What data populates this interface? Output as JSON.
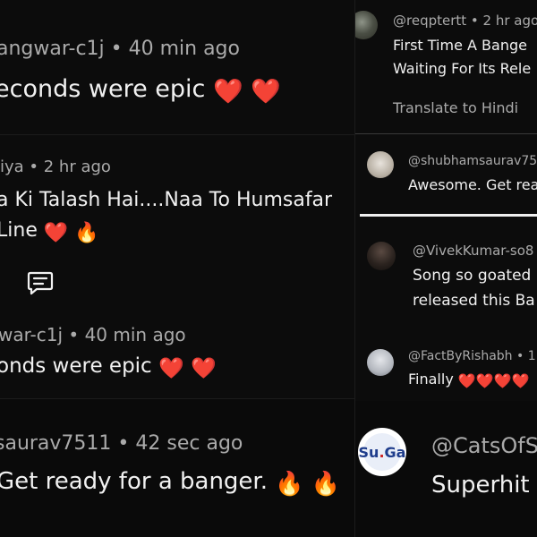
{
  "left_panels": [
    {
      "meta": "angwar-c1j • 40 min ago",
      "lines": [
        {
          "text": "econds were epic",
          "emoji": [
            "❤️",
            "❤️"
          ]
        }
      ]
    },
    {
      "meta": "iya • 2 hr ago",
      "lines": [
        {
          "text": "a Ki Talash Hai....Naa To Humsafar",
          "emoji": []
        },
        {
          "text": "Line",
          "emoji": [
            "❤️",
            "🔥"
          ]
        }
      ]
    },
    {
      "meta": "war-c1j • 40 min ago",
      "lines": [
        {
          "text": "onds were epic",
          "emoji": [
            "❤️",
            "❤️"
          ]
        }
      ]
    },
    {
      "meta": "saurav7511 • 42 sec ago",
      "lines": [
        {
          "text": "Get ready for a banger.",
          "emoji": [
            "🔥",
            "🔥"
          ]
        }
      ]
    }
  ],
  "right_comments": [
    {
      "handle": "@reqptertt • 2 hr ago",
      "lines": [
        "First Time A Bange",
        "Waiting For Its Rele"
      ],
      "translate": "Translate to Hindi"
    },
    {
      "handle": "@shubhamsaurav75",
      "lines": [
        "Awesome. Get rea"
      ]
    },
    {
      "handle": "@VivekKumar-so8",
      "lines": [
        "Song so goated",
        "released this Ba"
      ]
    },
    {
      "handle": "@FactByRishabh • 1",
      "lines": [
        "Finally"
      ],
      "emoji": [
        "❤️",
        "❤️",
        "❤️",
        "❤️"
      ]
    },
    {
      "handle": "@CatsOfS",
      "lines": [
        "Superhit"
      ],
      "avatar_logo": "Su Ga"
    }
  ],
  "icons": {
    "reply": "comment-icon"
  }
}
